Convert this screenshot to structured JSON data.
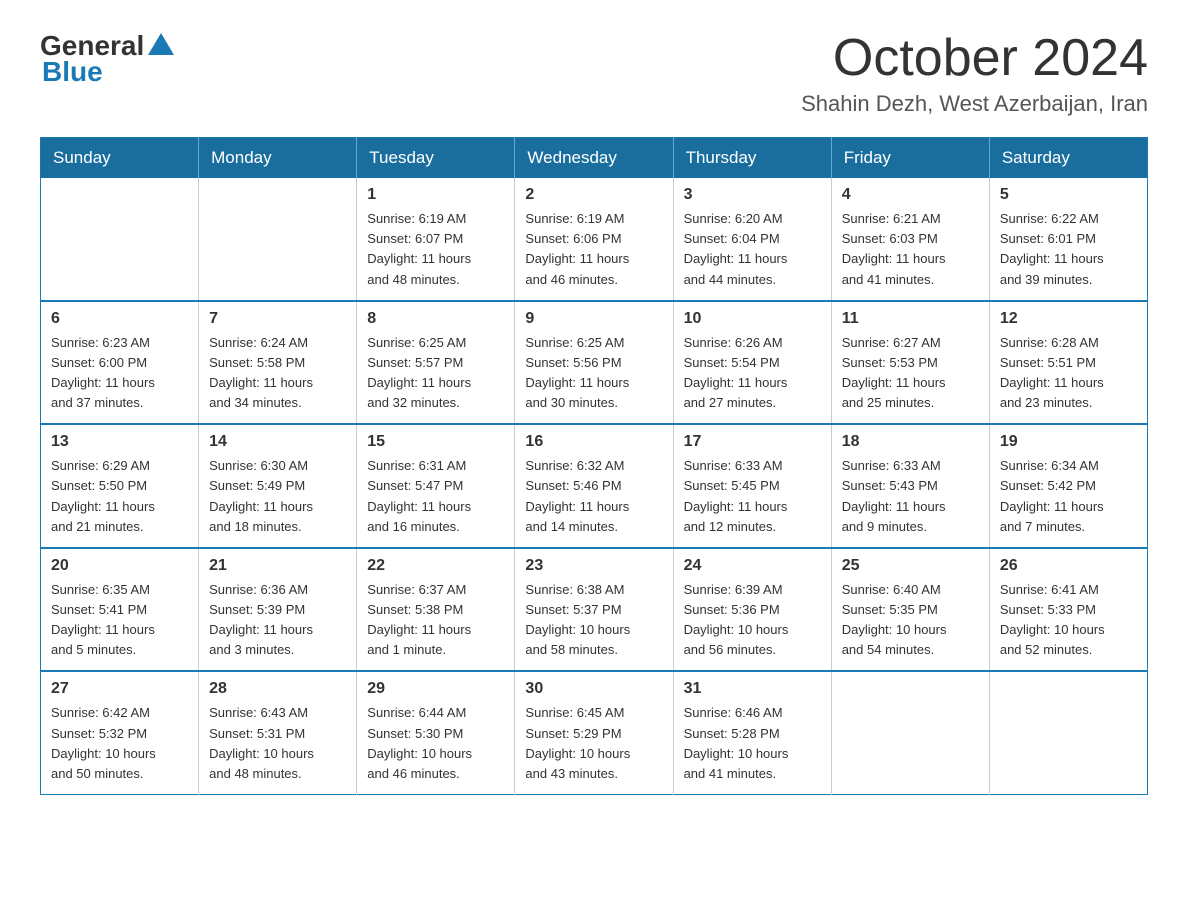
{
  "header": {
    "logo": {
      "general": "General",
      "blue": "Blue"
    },
    "title": "October 2024",
    "subtitle": "Shahin Dezh, West Azerbaijan, Iran"
  },
  "calendar": {
    "days_of_week": [
      "Sunday",
      "Monday",
      "Tuesday",
      "Wednesday",
      "Thursday",
      "Friday",
      "Saturday"
    ],
    "weeks": [
      [
        {
          "day": "",
          "info": ""
        },
        {
          "day": "",
          "info": ""
        },
        {
          "day": "1",
          "info": "Sunrise: 6:19 AM\nSunset: 6:07 PM\nDaylight: 11 hours\nand 48 minutes."
        },
        {
          "day": "2",
          "info": "Sunrise: 6:19 AM\nSunset: 6:06 PM\nDaylight: 11 hours\nand 46 minutes."
        },
        {
          "day": "3",
          "info": "Sunrise: 6:20 AM\nSunset: 6:04 PM\nDaylight: 11 hours\nand 44 minutes."
        },
        {
          "day": "4",
          "info": "Sunrise: 6:21 AM\nSunset: 6:03 PM\nDaylight: 11 hours\nand 41 minutes."
        },
        {
          "day": "5",
          "info": "Sunrise: 6:22 AM\nSunset: 6:01 PM\nDaylight: 11 hours\nand 39 minutes."
        }
      ],
      [
        {
          "day": "6",
          "info": "Sunrise: 6:23 AM\nSunset: 6:00 PM\nDaylight: 11 hours\nand 37 minutes."
        },
        {
          "day": "7",
          "info": "Sunrise: 6:24 AM\nSunset: 5:58 PM\nDaylight: 11 hours\nand 34 minutes."
        },
        {
          "day": "8",
          "info": "Sunrise: 6:25 AM\nSunset: 5:57 PM\nDaylight: 11 hours\nand 32 minutes."
        },
        {
          "day": "9",
          "info": "Sunrise: 6:25 AM\nSunset: 5:56 PM\nDaylight: 11 hours\nand 30 minutes."
        },
        {
          "day": "10",
          "info": "Sunrise: 6:26 AM\nSunset: 5:54 PM\nDaylight: 11 hours\nand 27 minutes."
        },
        {
          "day": "11",
          "info": "Sunrise: 6:27 AM\nSunset: 5:53 PM\nDaylight: 11 hours\nand 25 minutes."
        },
        {
          "day": "12",
          "info": "Sunrise: 6:28 AM\nSunset: 5:51 PM\nDaylight: 11 hours\nand 23 minutes."
        }
      ],
      [
        {
          "day": "13",
          "info": "Sunrise: 6:29 AM\nSunset: 5:50 PM\nDaylight: 11 hours\nand 21 minutes."
        },
        {
          "day": "14",
          "info": "Sunrise: 6:30 AM\nSunset: 5:49 PM\nDaylight: 11 hours\nand 18 minutes."
        },
        {
          "day": "15",
          "info": "Sunrise: 6:31 AM\nSunset: 5:47 PM\nDaylight: 11 hours\nand 16 minutes."
        },
        {
          "day": "16",
          "info": "Sunrise: 6:32 AM\nSunset: 5:46 PM\nDaylight: 11 hours\nand 14 minutes."
        },
        {
          "day": "17",
          "info": "Sunrise: 6:33 AM\nSunset: 5:45 PM\nDaylight: 11 hours\nand 12 minutes."
        },
        {
          "day": "18",
          "info": "Sunrise: 6:33 AM\nSunset: 5:43 PM\nDaylight: 11 hours\nand 9 minutes."
        },
        {
          "day": "19",
          "info": "Sunrise: 6:34 AM\nSunset: 5:42 PM\nDaylight: 11 hours\nand 7 minutes."
        }
      ],
      [
        {
          "day": "20",
          "info": "Sunrise: 6:35 AM\nSunset: 5:41 PM\nDaylight: 11 hours\nand 5 minutes."
        },
        {
          "day": "21",
          "info": "Sunrise: 6:36 AM\nSunset: 5:39 PM\nDaylight: 11 hours\nand 3 minutes."
        },
        {
          "day": "22",
          "info": "Sunrise: 6:37 AM\nSunset: 5:38 PM\nDaylight: 11 hours\nand 1 minute."
        },
        {
          "day": "23",
          "info": "Sunrise: 6:38 AM\nSunset: 5:37 PM\nDaylight: 10 hours\nand 58 minutes."
        },
        {
          "day": "24",
          "info": "Sunrise: 6:39 AM\nSunset: 5:36 PM\nDaylight: 10 hours\nand 56 minutes."
        },
        {
          "day": "25",
          "info": "Sunrise: 6:40 AM\nSunset: 5:35 PM\nDaylight: 10 hours\nand 54 minutes."
        },
        {
          "day": "26",
          "info": "Sunrise: 6:41 AM\nSunset: 5:33 PM\nDaylight: 10 hours\nand 52 minutes."
        }
      ],
      [
        {
          "day": "27",
          "info": "Sunrise: 6:42 AM\nSunset: 5:32 PM\nDaylight: 10 hours\nand 50 minutes."
        },
        {
          "day": "28",
          "info": "Sunrise: 6:43 AM\nSunset: 5:31 PM\nDaylight: 10 hours\nand 48 minutes."
        },
        {
          "day": "29",
          "info": "Sunrise: 6:44 AM\nSunset: 5:30 PM\nDaylight: 10 hours\nand 46 minutes."
        },
        {
          "day": "30",
          "info": "Sunrise: 6:45 AM\nSunset: 5:29 PM\nDaylight: 10 hours\nand 43 minutes."
        },
        {
          "day": "31",
          "info": "Sunrise: 6:46 AM\nSunset: 5:28 PM\nDaylight: 10 hours\nand 41 minutes."
        },
        {
          "day": "",
          "info": ""
        },
        {
          "day": "",
          "info": ""
        }
      ]
    ]
  }
}
